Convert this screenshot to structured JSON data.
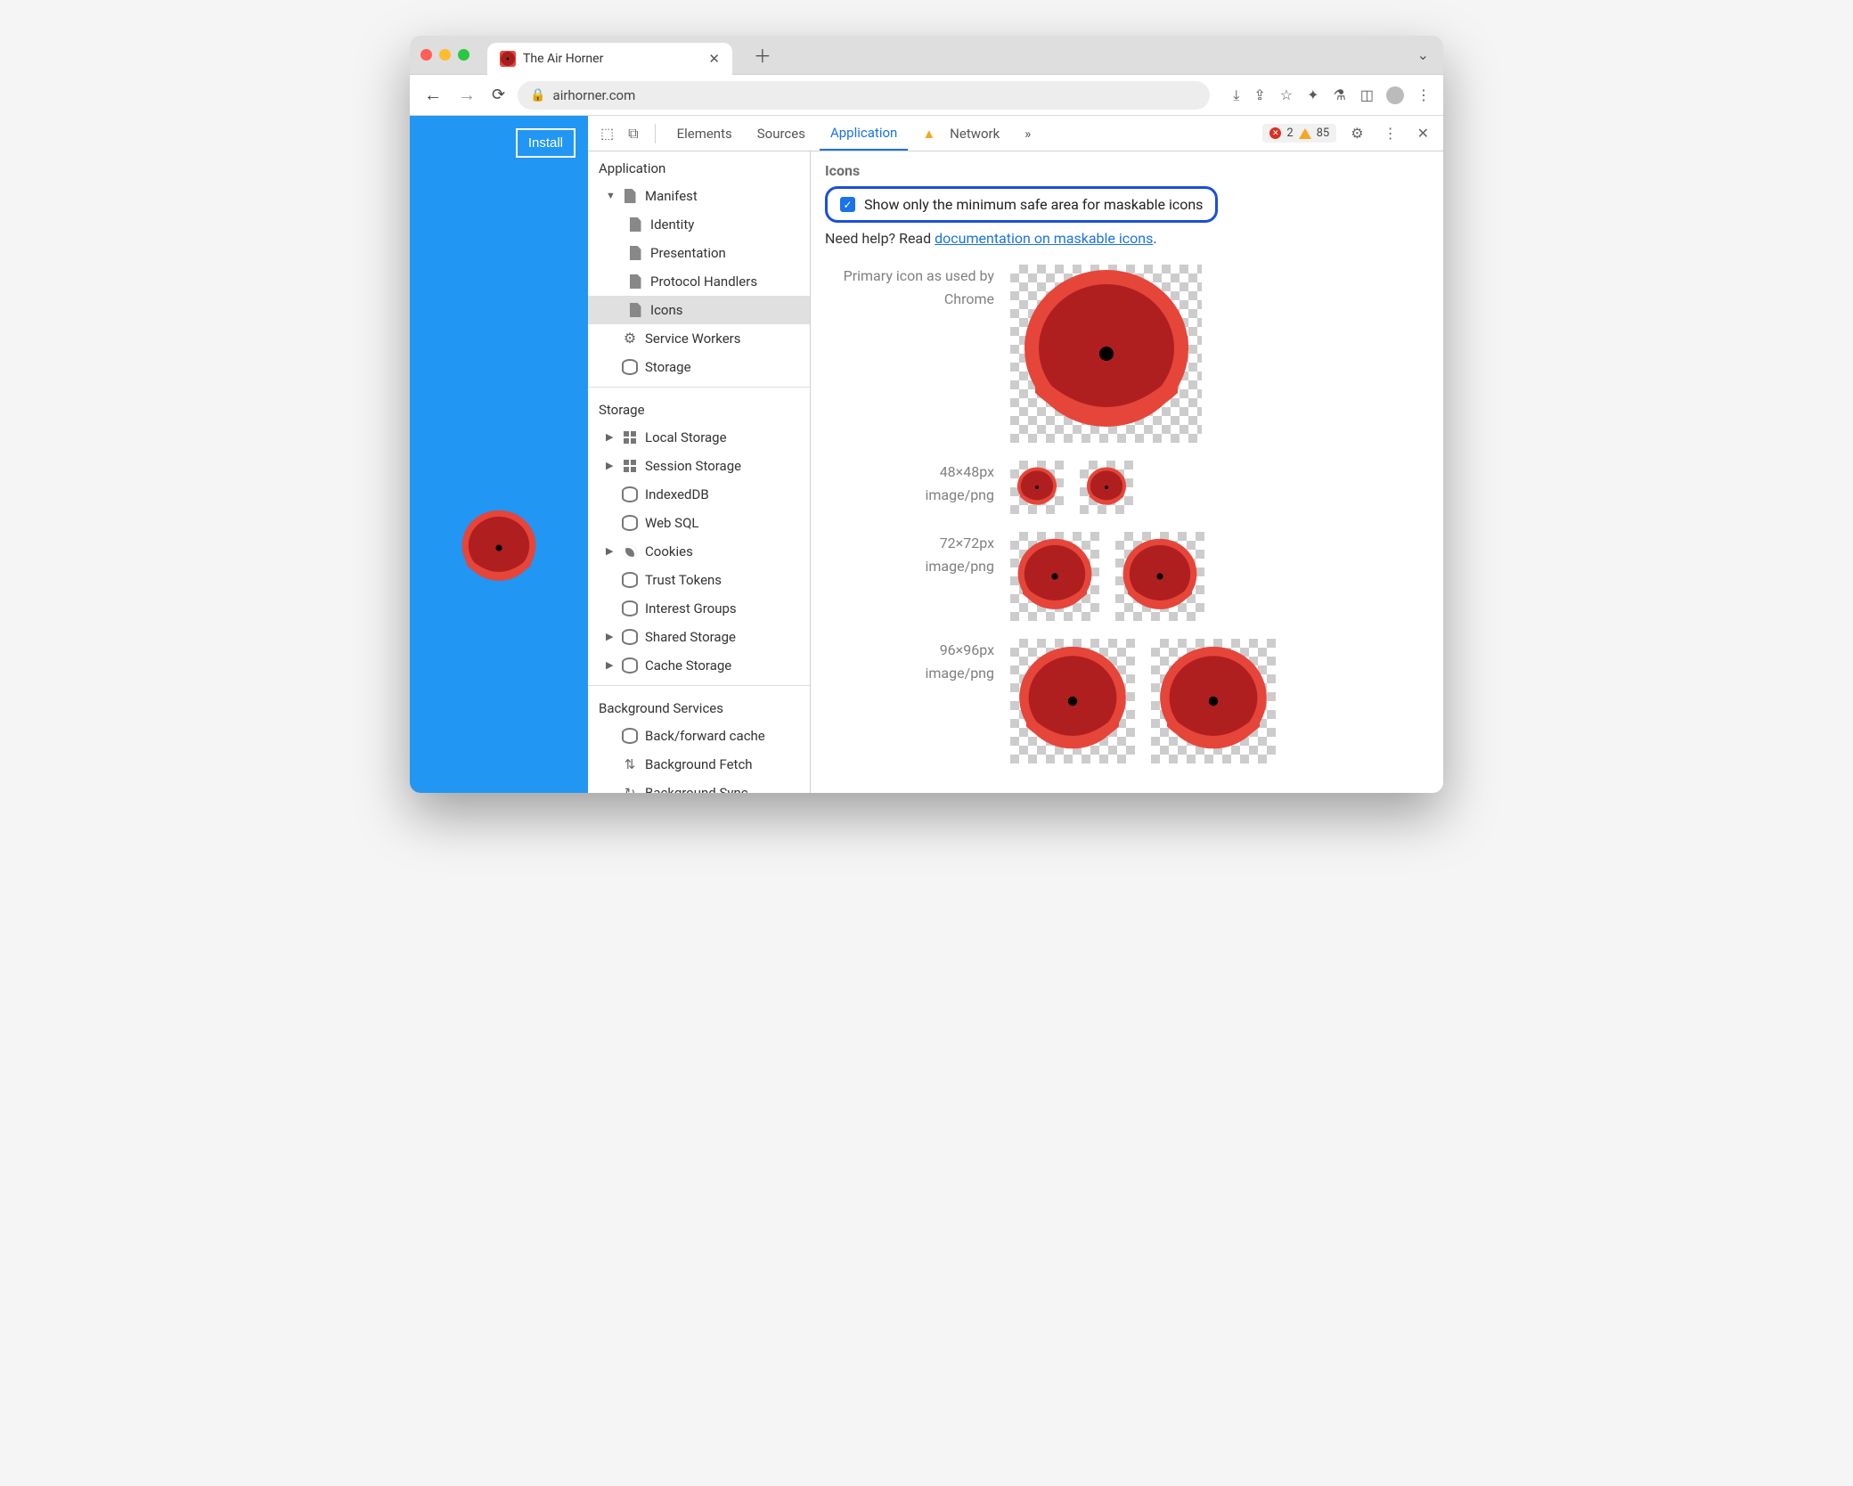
{
  "browser": {
    "tab_title": "The Air Horner",
    "url": "airhorner.com",
    "install_button": "Install"
  },
  "devtools": {
    "tabs": [
      "Elements",
      "Sources",
      "Application",
      "Network"
    ],
    "active_tab": "Application",
    "more_tabs_icon": "»",
    "issues": {
      "errors": "2",
      "warnings": "85"
    }
  },
  "sidebar": {
    "application": {
      "title": "Application",
      "manifest": "Manifest",
      "manifest_children": [
        "Identity",
        "Presentation",
        "Protocol Handlers",
        "Icons"
      ],
      "service_workers": "Service Workers",
      "storage_item": "Storage"
    },
    "storage": {
      "title": "Storage",
      "items": [
        "Local Storage",
        "Session Storage",
        "IndexedDB",
        "Web SQL",
        "Cookies",
        "Trust Tokens",
        "Interest Groups",
        "Shared Storage",
        "Cache Storage"
      ]
    },
    "background": {
      "title": "Background Services",
      "items": [
        "Back/forward cache",
        "Background Fetch",
        "Background Sync"
      ]
    }
  },
  "panel": {
    "title": "Icons",
    "checkbox_label": "Show only the minimum safe area for maskable icons",
    "help_prefix": "Need help? Read ",
    "help_link": "documentation on maskable icons",
    "help_suffix": ".",
    "primary_label_1": "Primary icon as used by",
    "primary_label_2": "Chrome",
    "rows": [
      {
        "size": "48×48px",
        "mime": "image/png"
      },
      {
        "size": "72×72px",
        "mime": "image/png"
      },
      {
        "size": "96×96px",
        "mime": "image/png"
      }
    ]
  }
}
